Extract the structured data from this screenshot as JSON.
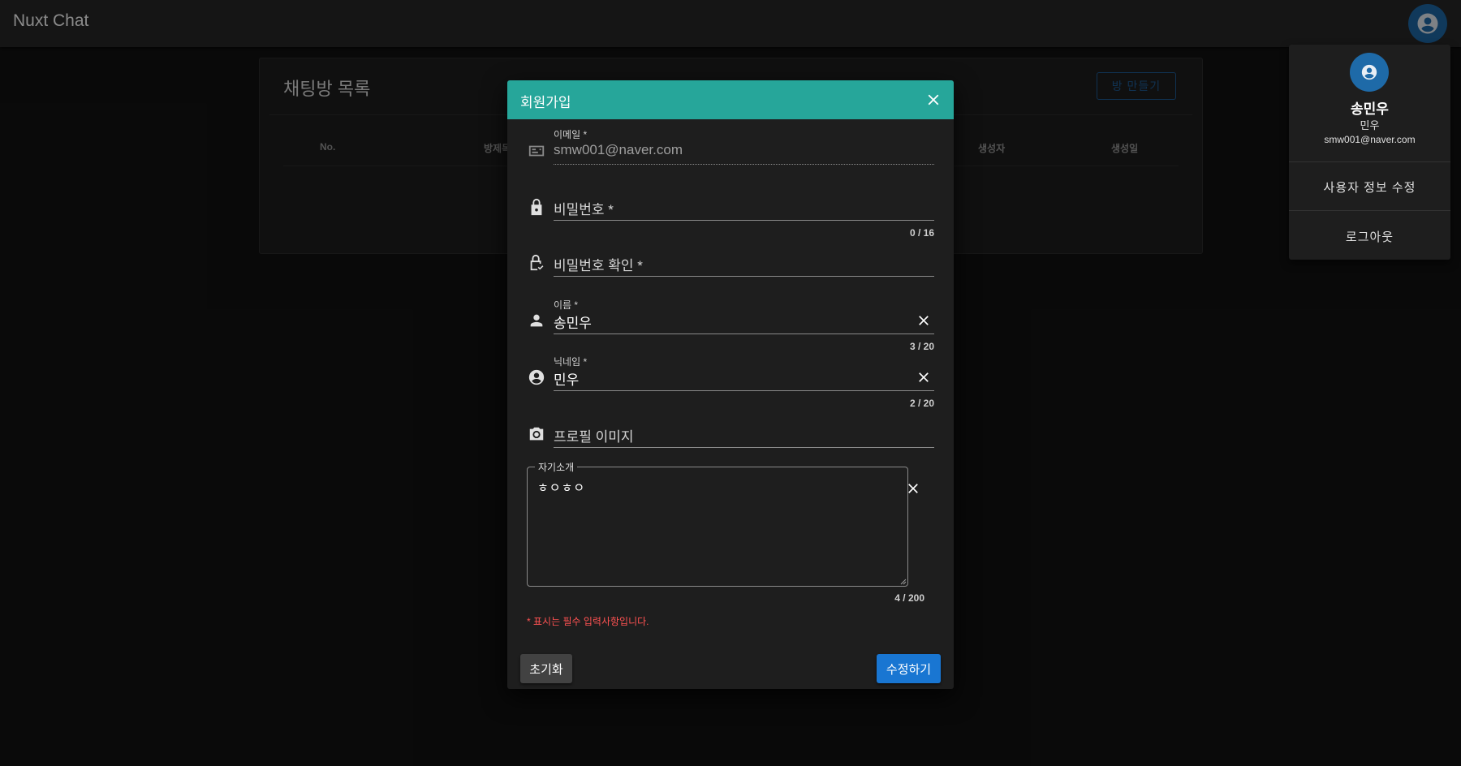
{
  "app": {
    "title": "Nuxt Chat"
  },
  "room_list": {
    "title": "채팅방 목록",
    "create_button": "방 만들기",
    "columns": [
      "No.",
      "방제목",
      "생성자",
      "생성일"
    ]
  },
  "user_menu": {
    "name": "송민우",
    "nickname": "민우",
    "email": "smw001@naver.com",
    "items": [
      "사용자 정보 수정",
      "로그아웃"
    ]
  },
  "dialog": {
    "title": "회원가입",
    "fields": {
      "email": {
        "label": "이메일 *",
        "value": "smw001@naver.com"
      },
      "password": {
        "placeholder": "비밀번호 *",
        "counter": "0 / 16"
      },
      "password_confirm": {
        "placeholder": "비밀번호 확인 *"
      },
      "name": {
        "label": "이름 *",
        "value": "송민우",
        "counter": "3 / 20"
      },
      "nickname": {
        "label": "닉네임 *",
        "value": "민우",
        "counter": "2 / 20"
      },
      "profile_image": {
        "placeholder": "프로필 이미지"
      },
      "bio": {
        "label": "자기소개",
        "value": "ㅎㅇㅎㅇ",
        "counter": "4 / 200"
      }
    },
    "required_note": "* 표시는 필수 입력사항입니다.",
    "reset_button": "초기화",
    "submit_button": "수정하기"
  },
  "colors": {
    "header": "#26a69a",
    "primary": "#1976d2",
    "error": "#ff5252",
    "avatar": "#1e6aa8"
  },
  "icons": [
    "account-circle-icon",
    "close-icon",
    "card-account-icon",
    "lock-icon",
    "lock-check-icon",
    "person-icon",
    "camera-icon"
  ]
}
